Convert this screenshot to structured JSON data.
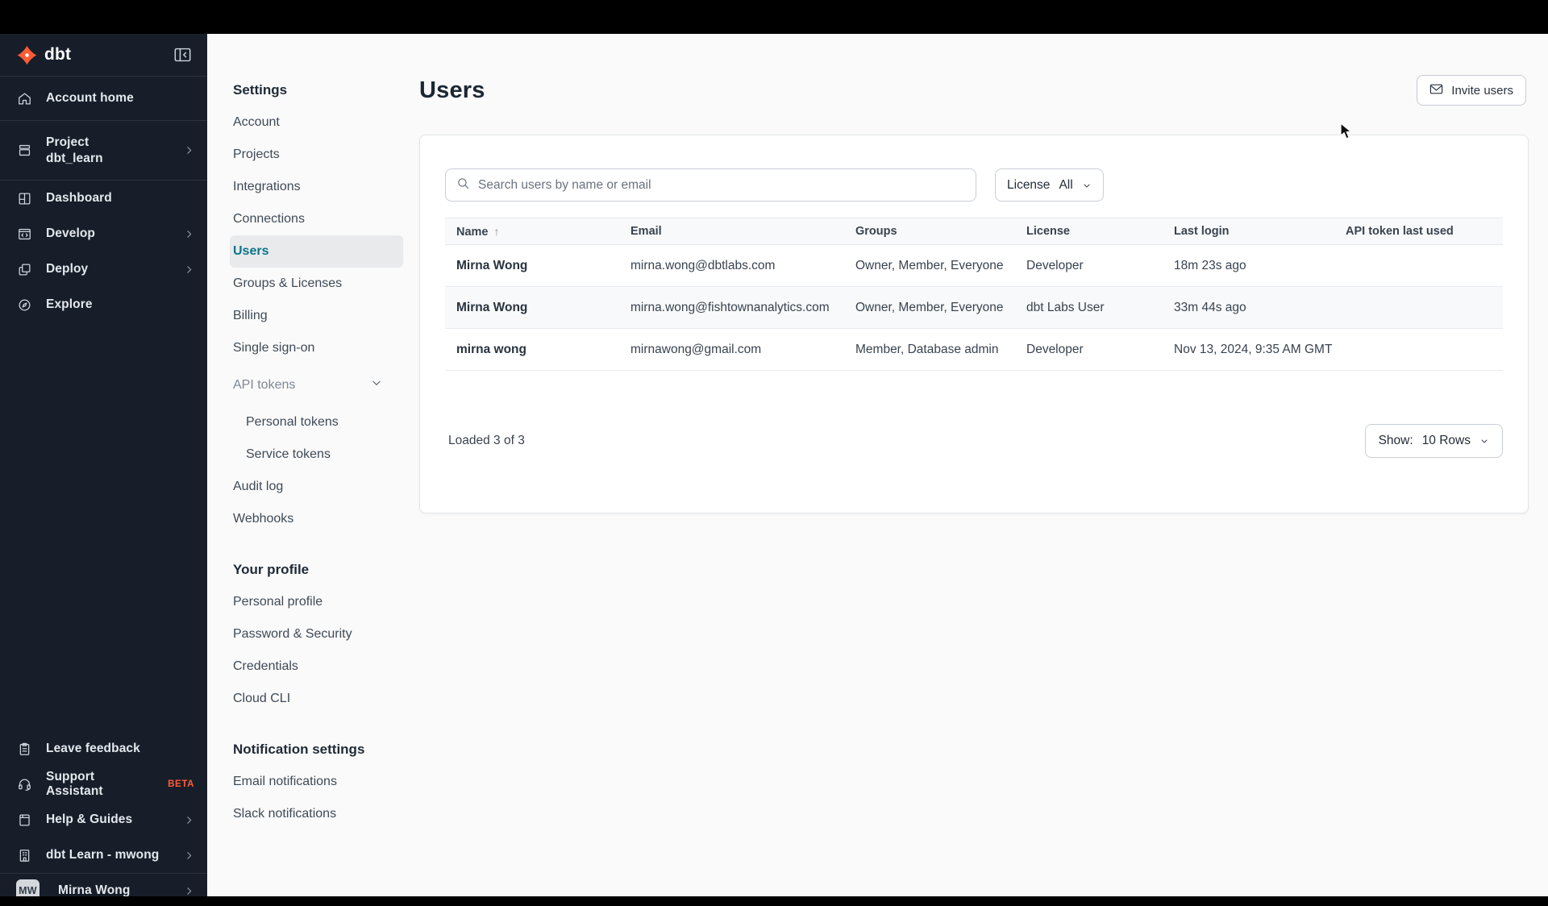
{
  "colors": {
    "sidebar_bg": "#171e2a",
    "brand_orange": "#ff5c35",
    "active_teal": "#0c7589",
    "beta_badge": "#ff5c35",
    "page_bg": "#fafafa"
  },
  "app": {
    "brand": "dbt"
  },
  "sidebar": {
    "items": [
      {
        "icon": "home",
        "label": "Account home"
      },
      {
        "icon": "project-box",
        "label": "Project",
        "sublabel": "dbt_learn"
      },
      {
        "icon": "dashboard-grid",
        "label": "Dashboard"
      },
      {
        "icon": "code-window",
        "label": "Develop"
      },
      {
        "icon": "stacked-squares",
        "label": "Deploy"
      },
      {
        "icon": "compass",
        "label": "Explore"
      }
    ],
    "footer_items": [
      {
        "icon": "clipboard",
        "label": "Leave feedback"
      },
      {
        "icon": "headset",
        "label": "Support Assistant",
        "badge": "BETA"
      },
      {
        "icon": "book",
        "label": "Help & Guides"
      },
      {
        "icon": "building",
        "label": "dbt Learn - mwong"
      }
    ],
    "user": {
      "initials": "MW",
      "name": "Mirna Wong"
    }
  },
  "settings_nav": {
    "title": "Settings",
    "items": [
      {
        "label": "Account"
      },
      {
        "label": "Projects"
      },
      {
        "label": "Integrations"
      },
      {
        "label": "Connections"
      },
      {
        "label": "Users",
        "active": true
      },
      {
        "label": "Groups & Licenses"
      },
      {
        "label": "Billing"
      },
      {
        "label": "Single sign-on"
      },
      {
        "label": "API tokens",
        "expandable": true
      },
      {
        "label": "Personal tokens",
        "sub": true
      },
      {
        "label": "Service tokens",
        "sub": true
      },
      {
        "label": "Audit log"
      },
      {
        "label": "Webhooks"
      }
    ],
    "profile_title": "Your profile",
    "profile_items": [
      {
        "label": "Personal profile"
      },
      {
        "label": "Password & Security"
      },
      {
        "label": "Credentials"
      },
      {
        "label": "Cloud CLI"
      }
    ],
    "notifications_title": "Notification settings",
    "notification_items": [
      {
        "label": "Email notifications"
      },
      {
        "label": "Slack notifications"
      }
    ]
  },
  "main": {
    "title": "Users",
    "invite_button": "Invite users",
    "search_placeholder": "Search users by name or email",
    "license_filter": {
      "label": "License",
      "value": "All"
    },
    "table": {
      "columns": [
        "Name",
        "Email",
        "Groups",
        "License",
        "Last login",
        "API token last used"
      ],
      "sort_indicator": "↑",
      "rows": [
        {
          "name": "Mirna Wong",
          "email": "mirna.wong@dbtlabs.com",
          "groups": "Owner, Member, Everyone",
          "license": "Developer",
          "last_login": "18m 23s ago",
          "api_token_last_used": ""
        },
        {
          "name": "Mirna Wong",
          "email": "mirna.wong@fishtownanalytics.com",
          "groups": "Owner, Member, Everyone",
          "license": "dbt Labs User",
          "last_login": "33m 44s ago",
          "api_token_last_used": ""
        },
        {
          "name": "mirna wong",
          "email": "mirnawong@gmail.com",
          "groups": "Member, Database admin",
          "license": "Developer",
          "last_login": "Nov 13, 2024, 9:35 AM GMT",
          "api_token_last_used": ""
        }
      ],
      "status": "Loaded 3 of 3",
      "show_label": "Show:",
      "show_value": "10 Rows"
    }
  }
}
